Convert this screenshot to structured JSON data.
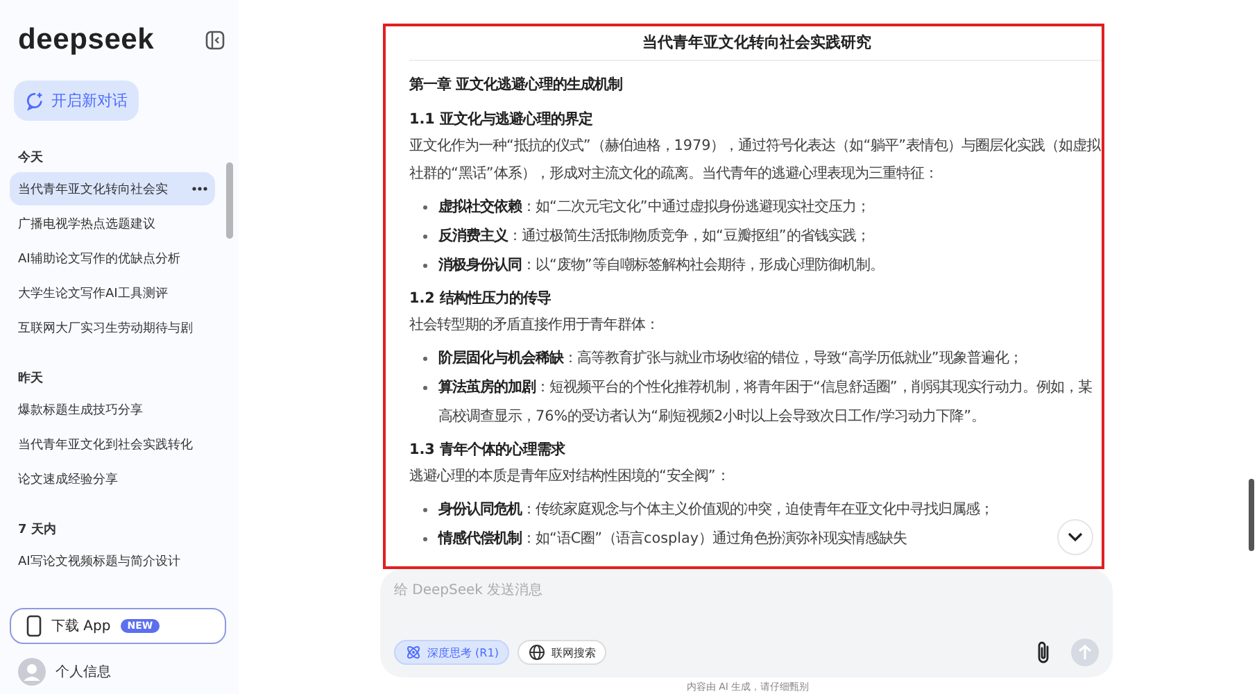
{
  "sidebar": {
    "logo": "deepseek",
    "new_chat": "开启新对话",
    "groups": [
      {
        "label": "今天",
        "items": [
          {
            "title": "当代青年亚文化转向社会实",
            "selected": true
          },
          {
            "title": "广播电视学热点选题建议",
            "selected": false
          },
          {
            "title": "AI辅助论文写作的优缺点分析",
            "selected": false
          },
          {
            "title": "大学生论文写作AI工具测评",
            "selected": false
          },
          {
            "title": "互联网大厂实习生劳动期待与剧",
            "selected": false
          }
        ]
      },
      {
        "label": "昨天",
        "items": [
          {
            "title": "爆款标题生成技巧分享",
            "selected": false
          },
          {
            "title": "当代青年亚文化到社会实践转化",
            "selected": false
          },
          {
            "title": "论文速成经验分享",
            "selected": false
          }
        ]
      },
      {
        "label": "7 天内",
        "items": [
          {
            "title": "AI写论文视频标题与简介设计",
            "selected": false
          }
        ]
      }
    ],
    "download": {
      "label": "下载 App",
      "badge": "NEW"
    },
    "profile": "个人信息"
  },
  "document": {
    "title": "当代青年亚文化转向社会实践研究",
    "blocks": [
      {
        "kind": "chapter",
        "text": "第一章 亚文化逃避心理的生成机制"
      },
      {
        "kind": "section",
        "text": "1.1 亚文化与逃避心理的界定"
      },
      {
        "kind": "paragraph",
        "text": "亚文化作为一种“抵抗的仪式”（赫伯迪格，1979），通过符号化表达（如“躺平”表情包）与圈层化实践（如虚拟社群的“黑话”体系），形成对主流文化的疏离。当代青年的逃避心理表现为三重特征："
      },
      {
        "kind": "list",
        "items": [
          "**虚拟社交依赖**：如“二次元宅文化”中通过虚拟身份逃避现实社交压力；",
          "**反消费主义**：通过极简生活抵制物质竞争，如“豆瓣抠组”的省钱实践；",
          "**消极身份认同**：以“废物”等自嘲标签解构社会期待，形成心理防御机制。"
        ]
      },
      {
        "kind": "section",
        "text": "1.2 结构性压力的传导"
      },
      {
        "kind": "paragraph",
        "text": "社会转型期的矛盾直接作用于青年群体："
      },
      {
        "kind": "list",
        "items": [
          "**阶层固化与机会稀缺**：高等教育扩张与就业市场收缩的错位，导致“高学历低就业”现象普遍化；",
          "**算法茧房的加剧**：短视频平台的个性化推荐机制，将青年困于“信息舒适圈”，削弱其现实行动力。例如，某高校调查显示，76%的受访者认为“刷短视频2小时以上会导致次日工作/学习动力下降”。"
        ]
      },
      {
        "kind": "section",
        "text": "1.3 青年个体的心理需求"
      },
      {
        "kind": "paragraph",
        "text": "逃避心理的本质是青年应对结构性困境的“安全阀”："
      },
      {
        "kind": "list",
        "items": [
          "**身份认同危机**：传统家庭观念与个体主义价值观的冲突，迫使青年在亚文化中寻找归属感；",
          "**情感代偿机制**：如“语C圈”（语言cosplay）通过角色扮演弥补现实情感缺失"
        ]
      }
    ]
  },
  "composer": {
    "placeholder": "给 DeepSeek 发送消息",
    "toggles": [
      {
        "kind": "think",
        "label": "深度思考 (R1)",
        "on": true
      },
      {
        "kind": "search",
        "label": "联网搜索",
        "on": false
      }
    ]
  },
  "footer": "内容由 AI 生成，请仔细甄别"
}
